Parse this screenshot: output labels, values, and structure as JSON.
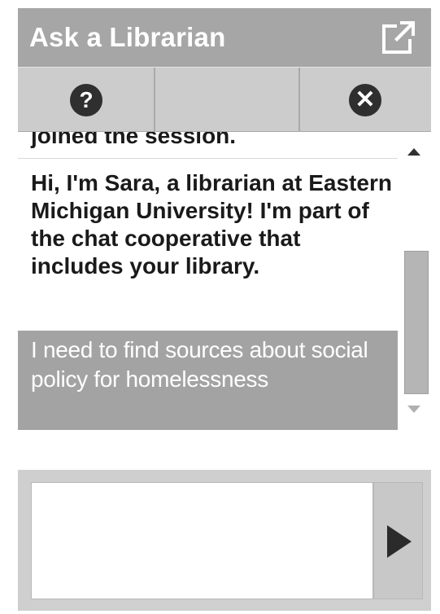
{
  "header": {
    "title": "Ask a Librarian",
    "popout_icon": "popout-icon"
  },
  "toolbar": {
    "help_icon": "help-icon",
    "help_glyph": "?",
    "close_icon": "close-icon",
    "close_glyph": "✕"
  },
  "transcript": {
    "messages": [
      {
        "type": "system",
        "text": "joined the session."
      },
      {
        "type": "librarian",
        "text": "Hi, I'm Sara, a librarian at Eastern Michigan University! I'm part of the chat cooperative that includes your library."
      },
      {
        "type": "patron",
        "text": "I need to find sources about social policy for homelessness"
      }
    ]
  },
  "composer": {
    "input_value": "",
    "send_icon": "send-icon"
  },
  "colors": {
    "header_bg": "#a6a6a6",
    "toolbar_bg": "#cccccc",
    "patron_msg_bg": "#a3a3a3",
    "icon_dark": "#2f2f2f"
  }
}
